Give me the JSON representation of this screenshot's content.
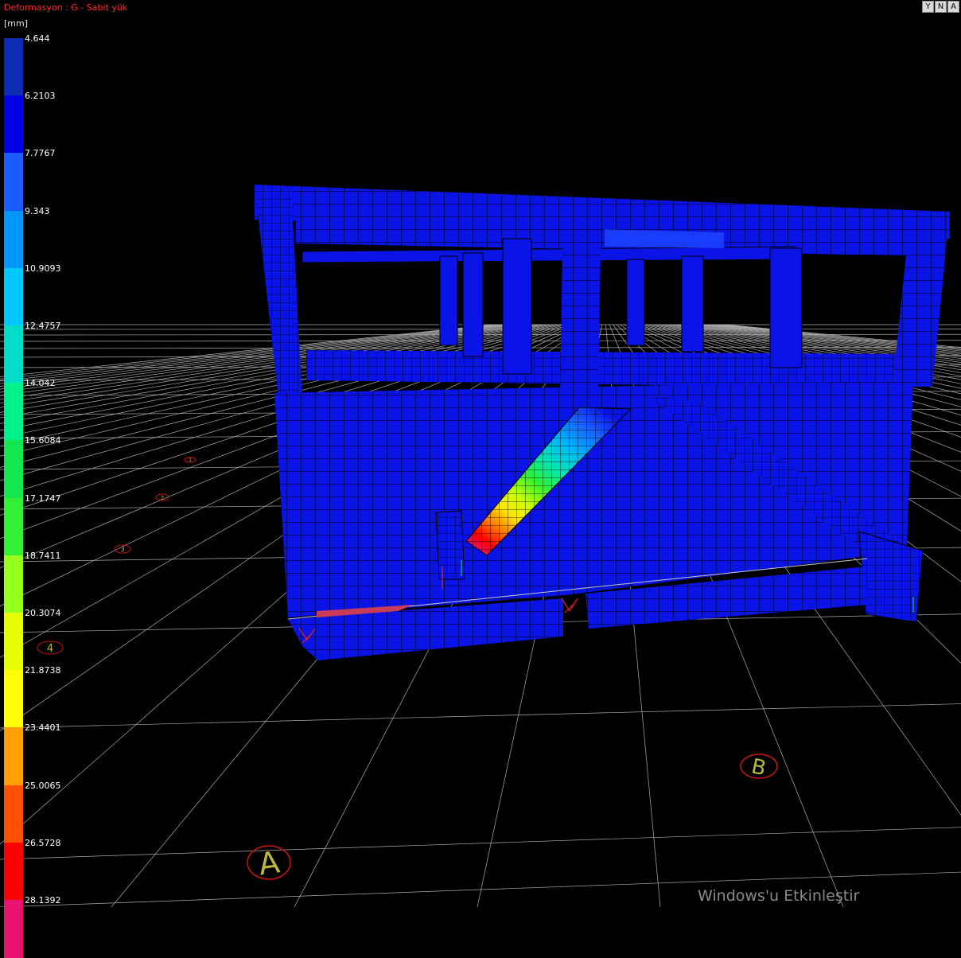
{
  "header": {
    "title": "Deformasyon : G  -  Sabit yük"
  },
  "legend": {
    "unit": "[mm]",
    "ticks": [
      "4.644",
      "6.2103",
      "7.7767",
      "9.343",
      "10.9093",
      "12.4757",
      "14.042",
      "15.6084",
      "17.1747",
      "18.7411",
      "20.3074",
      "21.8738",
      "23.4401",
      "25.0065",
      "26.5728",
      "28.1392"
    ],
    "colors": [
      "#0a2db4",
      "#0000e6",
      "#1a5cff",
      "#0096ff",
      "#00c8ff",
      "#00dcc8",
      "#00f08c",
      "#14e650",
      "#32f032",
      "#96ff1e",
      "#e6ff00",
      "#ffff00",
      "#ffa000",
      "#ff5000",
      "#ff0000",
      "#e6146e"
    ]
  },
  "toolbar": {
    "buttons": [
      {
        "label": "Y",
        "icon": "filter-icon"
      },
      {
        "label": "N",
        "icon": "north-icon"
      },
      {
        "label": "A",
        "icon": "arrow-up-icon"
      }
    ]
  },
  "axes": {
    "label_a": "A",
    "label_b": "B",
    "small_labels": [
      "4",
      "3",
      "2",
      "1"
    ]
  },
  "watermark": "Windows'u Etkinleştir",
  "colors": {
    "structure": "#0a14e6",
    "mesh": "#000000",
    "grid": "#cfcfcf",
    "axis_marker": "#b8b840",
    "axis_ring": "#c81414"
  }
}
